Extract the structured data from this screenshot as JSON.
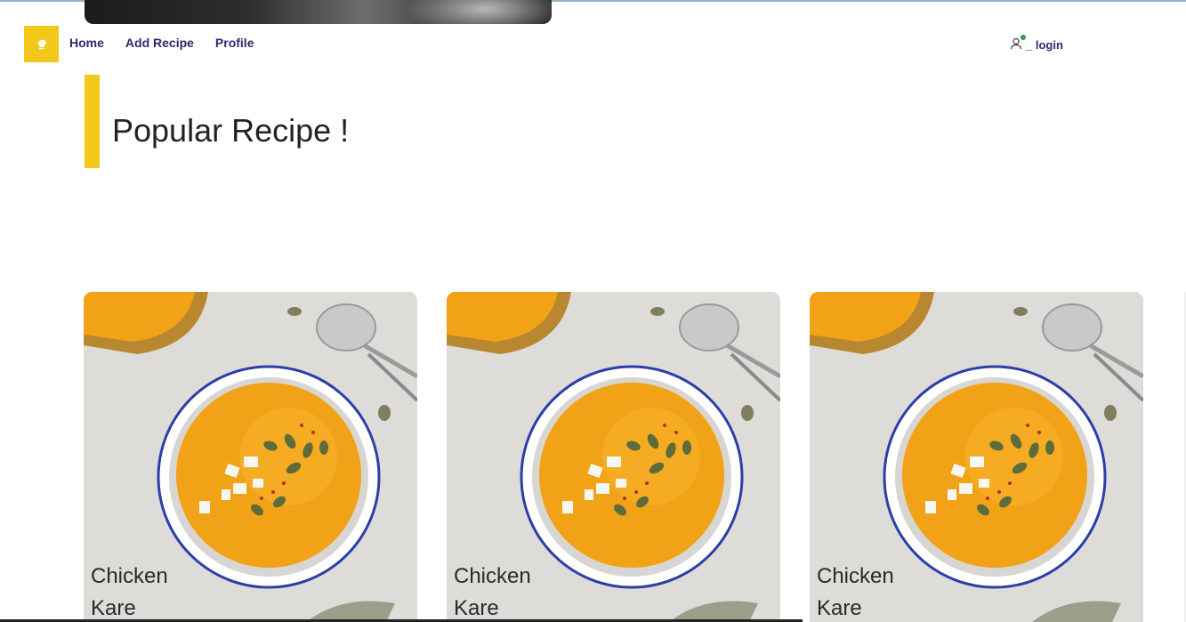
{
  "header": {
    "logo": {
      "icon": "chef-hat-icon",
      "color": "#f2c81b"
    },
    "nav": [
      {
        "label": "Home"
      },
      {
        "label": "Add Recipe"
      },
      {
        "label": "Profile"
      }
    ],
    "login": {
      "icon": "user-icon",
      "label": "_ login",
      "status_color": "#2e9e4a"
    }
  },
  "section": {
    "title": "Popular Recipe !"
  },
  "recipes": [
    {
      "name_line1": "Chicken",
      "name_line2": "Kare"
    },
    {
      "name_line1": "Chicken",
      "name_line2": "Kare"
    },
    {
      "name_line1": "Chicken",
      "name_line2": "Kare"
    }
  ],
  "colors": {
    "accent": "#f2c81b",
    "nav_text": "#2b2a6e",
    "soup": "#f2a216"
  }
}
